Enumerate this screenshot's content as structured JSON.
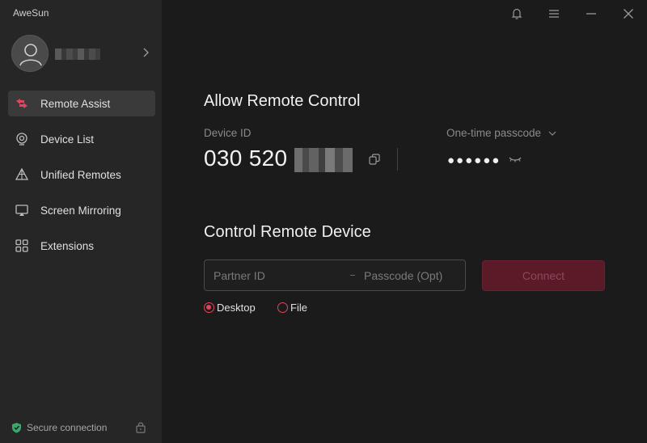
{
  "app": {
    "title": "AweSun"
  },
  "sidebar": {
    "items": [
      {
        "label": "Remote Assist",
        "icon": "remote-assist-icon",
        "active": true
      },
      {
        "label": "Device List",
        "icon": "device-list-icon"
      },
      {
        "label": "Unified Remotes",
        "icon": "unified-remotes-icon"
      },
      {
        "label": "Screen Mirroring",
        "icon": "screen-mirroring-icon"
      },
      {
        "label": "Extensions",
        "icon": "extensions-icon"
      }
    ],
    "secure_label": "Secure connection"
  },
  "allow": {
    "title": "Allow Remote Control",
    "device_id_label": "Device ID",
    "device_id_visible": "030 520",
    "otp_label": "One-time passcode",
    "passcode_masked": "●●●●●●"
  },
  "control": {
    "title": "Control Remote Device",
    "partner_placeholder": "Partner ID",
    "passcode_placeholder": "Passcode (Opt)",
    "connect_label": "Connect",
    "modes": [
      {
        "label": "Desktop",
        "selected": true
      },
      {
        "label": "File",
        "selected": false
      }
    ]
  },
  "colors": {
    "accent": "#e0445e",
    "connect_bg": "#5a1a28",
    "sidebar_bg": "#262626",
    "main_bg": "#1b1b1b"
  }
}
